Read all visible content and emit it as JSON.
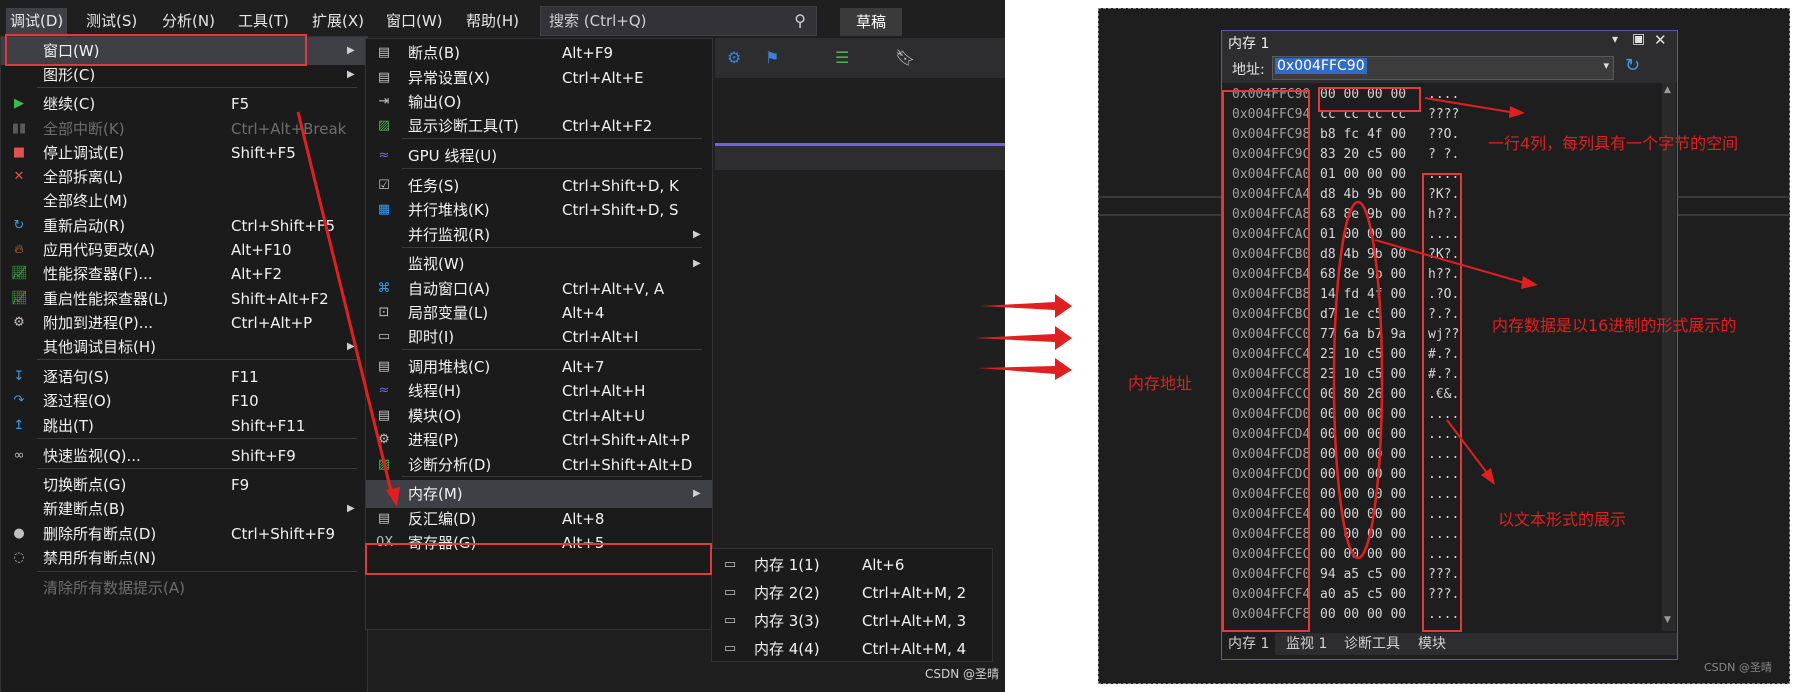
{
  "menubar": {
    "items": [
      "调试(D)",
      "测试(S)",
      "分析(N)",
      "工具(T)",
      "扩展(X)",
      "窗口(W)",
      "帮助(H)"
    ],
    "search_placeholder": "搜索 (Ctrl+Q)",
    "draft_label": "草稿"
  },
  "debug_menu": {
    "items": [
      {
        "label": "窗口(W)",
        "shortcut": "",
        "submenu": true,
        "icon": ""
      },
      {
        "label": "图形(C)",
        "shortcut": "",
        "submenu": true,
        "icon": ""
      },
      {
        "label": "继续(C)",
        "shortcut": "F5",
        "submenu": false,
        "icon": "play-icon"
      },
      {
        "label": "全部中断(K)",
        "shortcut": "Ctrl+Alt+Break",
        "submenu": false,
        "icon": "pause-icon",
        "disabled": true
      },
      {
        "label": "停止调试(E)",
        "shortcut": "Shift+F5",
        "submenu": false,
        "icon": "stop-icon"
      },
      {
        "label": "全部拆离(L)",
        "shortcut": "",
        "submenu": false,
        "icon": "detach-icon"
      },
      {
        "label": "全部终止(M)",
        "shortcut": "",
        "submenu": false,
        "icon": ""
      },
      {
        "label": "重新启动(R)",
        "shortcut": "Ctrl+Shift+F5",
        "submenu": false,
        "icon": "restart-icon"
      },
      {
        "label": "应用代码更改(A)",
        "shortcut": "Alt+F10",
        "submenu": false,
        "icon": "hot-reload-icon"
      },
      {
        "label": "性能探查器(F)...",
        "shortcut": "Alt+F2",
        "submenu": false,
        "icon": "profiler-icon"
      },
      {
        "label": "重启性能探查器(L)",
        "shortcut": "Shift+Alt+F2",
        "submenu": false,
        "icon": "profiler-icon"
      },
      {
        "label": "附加到进程(P)...",
        "shortcut": "Ctrl+Alt+P",
        "submenu": false,
        "icon": "gears-icon"
      },
      {
        "label": "其他调试目标(H)",
        "shortcut": "",
        "submenu": true,
        "icon": ""
      },
      {
        "label": "逐语句(S)",
        "shortcut": "F11",
        "submenu": false,
        "icon": "step-into-icon"
      },
      {
        "label": "逐过程(O)",
        "shortcut": "F10",
        "submenu": false,
        "icon": "step-over-icon"
      },
      {
        "label": "跳出(T)",
        "shortcut": "Shift+F11",
        "submenu": false,
        "icon": "step-out-icon"
      },
      {
        "label": "快速监视(Q)...",
        "shortcut": "Shift+F9",
        "submenu": false,
        "icon": "glasses-icon"
      },
      {
        "label": "切换断点(G)",
        "shortcut": "F9",
        "submenu": false,
        "icon": ""
      },
      {
        "label": "新建断点(B)",
        "shortcut": "",
        "submenu": true,
        "icon": ""
      },
      {
        "label": "删除所有断点(D)",
        "shortcut": "Ctrl+Shift+F9",
        "submenu": false,
        "icon": "delete-breakpoints-icon"
      },
      {
        "label": "禁用所有断点(N)",
        "shortcut": "",
        "submenu": false,
        "icon": "disable-breakpoints-icon"
      },
      {
        "label": "清除所有数据提示(A)",
        "shortcut": "",
        "submenu": false,
        "icon": "",
        "disabled": true
      }
    ]
  },
  "window_menu": {
    "items": [
      {
        "label": "断点(B)",
        "shortcut": "Alt+F9",
        "icon": "breakpoint-window-icon"
      },
      {
        "label": "异常设置(X)",
        "shortcut": "Ctrl+Alt+E",
        "icon": "exception-icon"
      },
      {
        "label": "输出(O)",
        "shortcut": "",
        "icon": "output-icon"
      },
      {
        "label": "显示诊断工具(T)",
        "shortcut": "Ctrl+Alt+F2",
        "icon": "diagnostics-icon"
      },
      {
        "label": "GPU 线程(U)",
        "shortcut": "",
        "icon": "gpu-thread-icon"
      },
      {
        "label": "任务(S)",
        "shortcut": "Ctrl+Shift+D, K",
        "icon": "tasks-icon"
      },
      {
        "label": "并行堆栈(K)",
        "shortcut": "Ctrl+Shift+D, S",
        "icon": "parallel-stacks-icon"
      },
      {
        "label": "并行监视(R)",
        "shortcut": "",
        "icon": "",
        "submenu": true
      },
      {
        "label": "监视(W)",
        "shortcut": "",
        "icon": "",
        "submenu": true
      },
      {
        "label": "自动窗口(A)",
        "shortcut": "Ctrl+Alt+V, A",
        "icon": "autos-icon"
      },
      {
        "label": "局部变量(L)",
        "shortcut": "Alt+4",
        "icon": "locals-icon"
      },
      {
        "label": "即时(I)",
        "shortcut": "Ctrl+Alt+I",
        "icon": "immediate-icon"
      },
      {
        "label": "调用堆栈(C)",
        "shortcut": "Alt+7",
        "icon": "call-stack-icon"
      },
      {
        "label": "线程(H)",
        "shortcut": "Ctrl+Alt+H",
        "icon": "threads-icon"
      },
      {
        "label": "模块(O)",
        "shortcut": "Ctrl+Alt+U",
        "icon": "modules-icon"
      },
      {
        "label": "进程(P)",
        "shortcut": "Ctrl+Shift+Alt+P",
        "icon": "process-icon"
      },
      {
        "label": "诊断分析(D)",
        "shortcut": "Ctrl+Shift+Alt+D",
        "icon": "diagnostics-icon"
      },
      {
        "label": "内存(M)",
        "shortcut": "",
        "icon": "",
        "submenu": true
      },
      {
        "label": "反汇编(D)",
        "shortcut": "Alt+8",
        "icon": "disassembly-icon"
      },
      {
        "label": "寄存器(G)",
        "shortcut": "Alt+5",
        "icon": "registers-icon"
      }
    ]
  },
  "memory_submenu": {
    "items": [
      {
        "label": "内存 1(1)",
        "shortcut": "Alt+6"
      },
      {
        "label": "内存 2(2)",
        "shortcut": "Ctrl+Alt+M, 2"
      },
      {
        "label": "内存 3(3)",
        "shortcut": "Ctrl+Alt+M, 3"
      },
      {
        "label": "内存 4(4)",
        "shortcut": "Ctrl+Alt+M, 4"
      }
    ]
  },
  "watermark": "CSDN @圣晴",
  "memory_window": {
    "title": "内存 1",
    "address_label": "地址:",
    "address_value": "0x004FFC90",
    "rows": [
      {
        "addr": "0x004FFC90",
        "hex": "00 00 00 00",
        "text": "...."
      },
      {
        "addr": "0x004FFC94",
        "hex": "cc cc cc cc",
        "text": "????"
      },
      {
        "addr": "0x004FFC98",
        "hex": "b8 fc 4f 00",
        "text": "??O."
      },
      {
        "addr": "0x004FFC9C",
        "hex": "83 20 c5 00",
        "text": "? ?."
      },
      {
        "addr": "0x004FFCA0",
        "hex": "01 00 00 00",
        "text": "...."
      },
      {
        "addr": "0x004FFCA4",
        "hex": "d8 4b 9b 00",
        "text": "?K?."
      },
      {
        "addr": "0x004FFCA8",
        "hex": "68 8e 9b 00",
        "text": "h??."
      },
      {
        "addr": "0x004FFCAC",
        "hex": "01 00 00 00",
        "text": "...."
      },
      {
        "addr": "0x004FFCB0",
        "hex": "d8 4b 9b 00",
        "text": "?K?."
      },
      {
        "addr": "0x004FFCB4",
        "hex": "68 8e 9b 00",
        "text": "h??."
      },
      {
        "addr": "0x004FFCB8",
        "hex": "14 fd 4f 00",
        "text": ".?O."
      },
      {
        "addr": "0x004FFCBC",
        "hex": "d7 1e c5 00",
        "text": "?.?."
      },
      {
        "addr": "0x004FFCC0",
        "hex": "77 6a b7 9a",
        "text": "wj??"
      },
      {
        "addr": "0x004FFCC4",
        "hex": "23 10 c5 00",
        "text": "#.?."
      },
      {
        "addr": "0x004FFCC8",
        "hex": "23 10 c5 00",
        "text": "#.?."
      },
      {
        "addr": "0x004FFCCC",
        "hex": "00 80 26 00",
        "text": ".€&."
      },
      {
        "addr": "0x004FFCD0",
        "hex": "00 00 00 00",
        "text": "...."
      },
      {
        "addr": "0x004FFCD4",
        "hex": "00 00 00 00",
        "text": "...."
      },
      {
        "addr": "0x004FFCD8",
        "hex": "00 00 00 00",
        "text": "...."
      },
      {
        "addr": "0x004FFCDC",
        "hex": "00 00 00 00",
        "text": "...."
      },
      {
        "addr": "0x004FFCE0",
        "hex": "00 00 00 00",
        "text": "...."
      },
      {
        "addr": "0x004FFCE4",
        "hex": "00 00 00 00",
        "text": "...."
      },
      {
        "addr": "0x004FFCE8",
        "hex": "00 00 00 00",
        "text": "...."
      },
      {
        "addr": "0x004FFCEC",
        "hex": "00 00 00 00",
        "text": "...."
      },
      {
        "addr": "0x004FFCF0",
        "hex": "94 a5 c5 00",
        "text": "???."
      },
      {
        "addr": "0x004FFCF4",
        "hex": "a0 a5 c5 00",
        "text": "???."
      },
      {
        "addr": "0x004FFCF8",
        "hex": "00 00 00 00",
        "text": "...."
      }
    ],
    "bottom_tabs": [
      "内存 1",
      "监视 1",
      "诊断工具",
      "模块"
    ]
  },
  "annotations": {
    "columns_note": "一行4列，每列具有一个字节的空间",
    "hex_note": "内存数据是以16进制的形式展示的",
    "address_note": "内存地址",
    "text_note": "以文本形式的展示"
  },
  "colors": {
    "highlight_box": "#e03a3a",
    "menu_bg": "#1b1b1c"
  }
}
